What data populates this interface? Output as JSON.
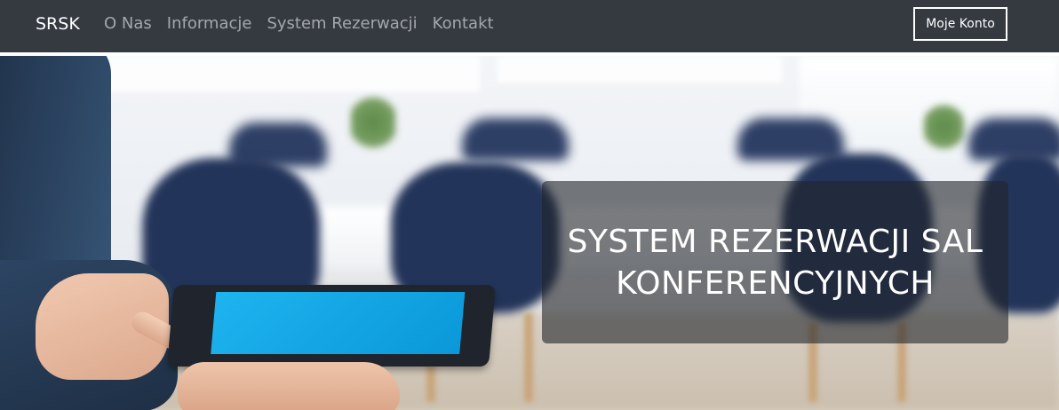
{
  "navbar": {
    "brand": "SRSK",
    "links": [
      {
        "label": "O Nas"
      },
      {
        "label": "Informacje"
      },
      {
        "label": "System Rezerwacji"
      },
      {
        "label": "Kontakt"
      }
    ],
    "account_button": "Moje Konto"
  },
  "hero": {
    "title": "SYSTEM REZERWACJI SAL KONFERENCYJNYCH"
  },
  "colors": {
    "navbar_bg": "#343a40",
    "overlay_bg": "#212529",
    "tablet_screen": "#1eb4f0"
  }
}
